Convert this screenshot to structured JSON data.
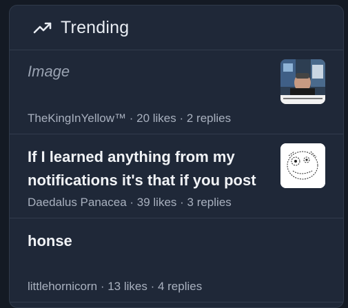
{
  "widget": {
    "title": "Trending",
    "icon": "trending-up-icon"
  },
  "posts": [
    {
      "title": "Image",
      "meta": "TheKingInYellow™ · 20 likes · 2 replies",
      "thumbnail": "video-stream-thumbnail"
    },
    {
      "title": "If I learned anything from my notifications it's that if you post",
      "meta": "Daedalus Panacea · 39 likes · 3 replies",
      "thumbnail": "sketch-drawing-thumbnail"
    },
    {
      "title": "honse",
      "meta": "littlehornicorn · 13 likes · 4 replies"
    }
  ],
  "colors": {
    "background": "#141a24",
    "card": "#1f2838",
    "divider": "#323c4d",
    "text_primary": "#f1f3f6",
    "text_muted": "#a9b1bf"
  }
}
